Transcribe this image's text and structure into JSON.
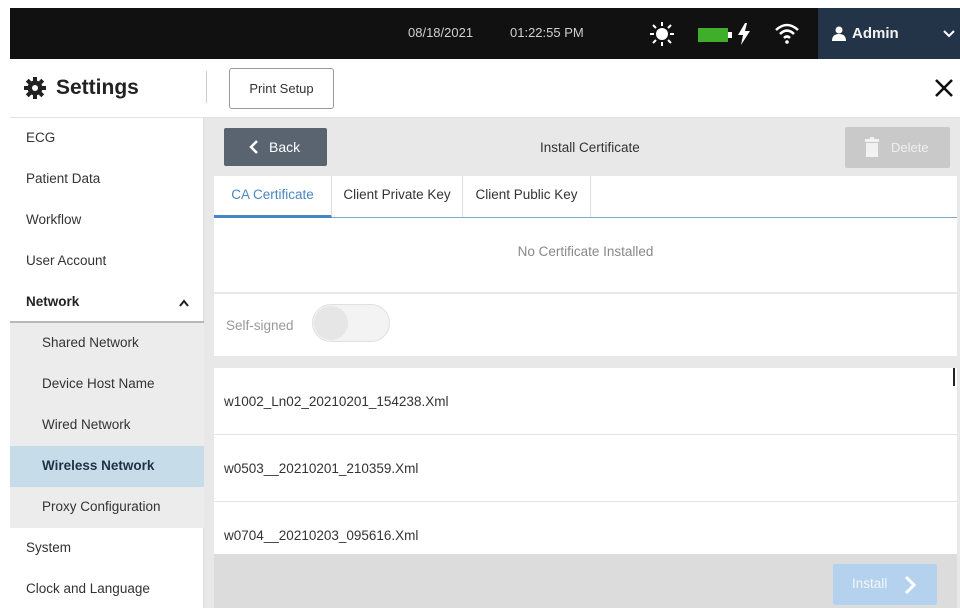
{
  "status_bar": {
    "date": "08/18/2021",
    "time": "01:22:55 PM",
    "user": "Admin",
    "icons": [
      "sun-icon",
      "battery-icon",
      "bolt-icon",
      "wifi-icon",
      "user-icon",
      "chevron-down-icon"
    ],
    "battery_color": "#3fae2a"
  },
  "header": {
    "title": "Settings",
    "print_setup_label": "Print Setup"
  },
  "sidebar": {
    "items": [
      {
        "label": "ECG"
      },
      {
        "label": "Patient Data"
      },
      {
        "label": "Workflow"
      },
      {
        "label": "User Account"
      },
      {
        "label": "Network",
        "expanded": true
      },
      {
        "label": "Shared Network"
      },
      {
        "label": "Device Host Name"
      },
      {
        "label": "Wired Network"
      },
      {
        "label": "Wireless Network",
        "active": true
      },
      {
        "label": "Proxy Configuration"
      },
      {
        "label": "System"
      },
      {
        "label": "Clock and Language"
      }
    ]
  },
  "main": {
    "back_label": "Back",
    "page_title": "Install Certificate",
    "delete_label": "Delete",
    "tabs": [
      {
        "label": "CA Certificate",
        "active": true
      },
      {
        "label": "Client Private Key"
      },
      {
        "label": "Client Public Key"
      }
    ],
    "no_certificate_text": "No Certificate Installed",
    "self_signed_label": "Self-signed",
    "self_signed_on": false,
    "files": [
      {
        "name": "w1002_Ln02_20210201_154238.Xml"
      },
      {
        "name": "w0503__20210201_210359.Xml"
      },
      {
        "name": "w0704__20210203_095616.Xml"
      }
    ],
    "install_label": "Install"
  },
  "colors": {
    "accent": "#4a86c2",
    "active_item_bg": "#c7dce9",
    "admin_bg": "#243448",
    "back_btn_bg": "#5a6470",
    "install_btn_bg": "#b4d2ed"
  }
}
